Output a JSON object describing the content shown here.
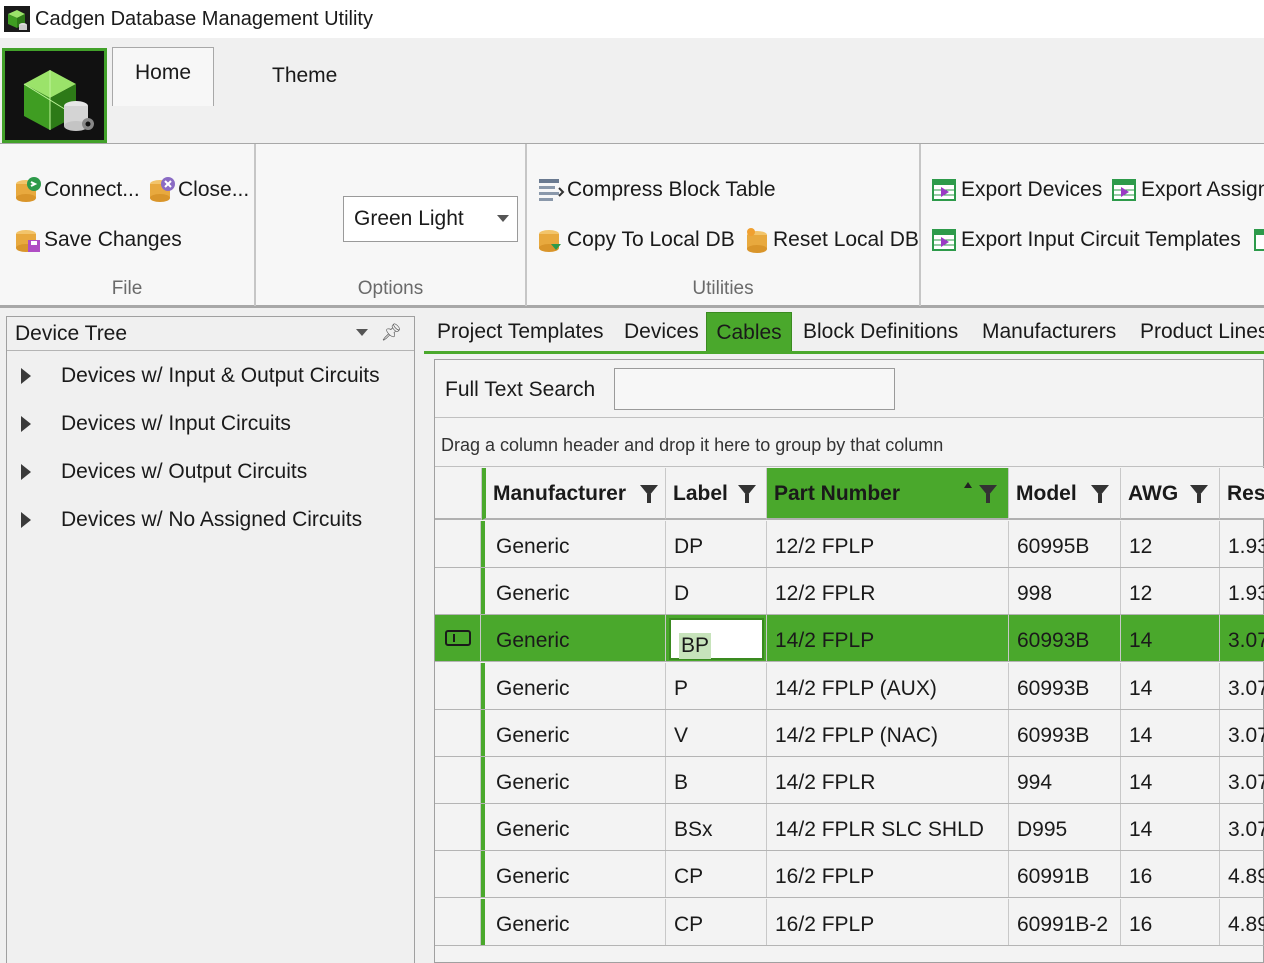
{
  "window": {
    "title": "Cadgen Database Management Utility"
  },
  "ribbon": {
    "tabs": [
      "Home"
    ],
    "groups": {
      "file": {
        "label": "File",
        "connect": "Connect...",
        "close": "Close...",
        "save": "Save Changes"
      },
      "options": {
        "label": "Options",
        "theme_label": "Theme",
        "theme_value": "Green Light"
      },
      "utilities": {
        "label": "Utilities",
        "compress": "Compress Block Table",
        "copy": "Copy To Local DB",
        "reset": "Reset Local DB"
      },
      "export": {
        "export_devices": "Export Devices",
        "export_assign": "Export Assign",
        "export_input": "Export Input Circuit Templates"
      }
    }
  },
  "device_tree": {
    "title": "Device Tree",
    "items": [
      "Devices w/ Input & Output Circuits",
      "Devices w/ Input Circuits",
      "Devices w/ Output Circuits",
      "Devices w/ No Assigned Circuits"
    ]
  },
  "doc_tabs": [
    "Project Templates",
    "Devices",
    "Cables",
    "Block Definitions",
    "Manufacturers",
    "Product Lines"
  ],
  "active_tab": "Cables",
  "search": {
    "label": "Full Text Search",
    "value": ""
  },
  "group_panel_text": "Drag a column header and drop it here to group by that column",
  "grid": {
    "columns": [
      "Manufacturer",
      "Label",
      "Part Number",
      "Model",
      "AWG",
      "Resi"
    ],
    "sorted_column": "Part Number",
    "rows": [
      [
        "Generic",
        "DP",
        "12/2 FPLP",
        "60995B",
        "12",
        "1.93"
      ],
      [
        "Generic",
        "D",
        "12/2 FPLR",
        "998",
        "12",
        "1.93"
      ],
      [
        "Generic",
        "BP",
        "14/2 FPLP",
        "60993B",
        "14",
        "3.07"
      ],
      [
        "Generic",
        "P",
        "14/2 FPLP (AUX)",
        "60993B",
        "14",
        "3.07"
      ],
      [
        "Generic",
        "V",
        "14/2 FPLP (NAC)",
        "60993B",
        "14",
        "3.07"
      ],
      [
        "Generic",
        "B",
        "14/2 FPLR",
        "994",
        "14",
        "3.07"
      ],
      [
        "Generic",
        "BSx",
        "14/2 FPLR SLC SHLD",
        "D995",
        "14",
        "3.07"
      ],
      [
        "Generic",
        "CP",
        "16/2 FPLP",
        "60991B",
        "16",
        "4.89"
      ],
      [
        "Generic",
        "CP",
        "16/2 FPLP",
        "60991B-2",
        "16",
        "4.89"
      ]
    ],
    "selected_row": 2,
    "editing_cell_value": "BP"
  },
  "colors": {
    "accent": "#4aa82c",
    "accent_dark": "#3a8a20"
  }
}
